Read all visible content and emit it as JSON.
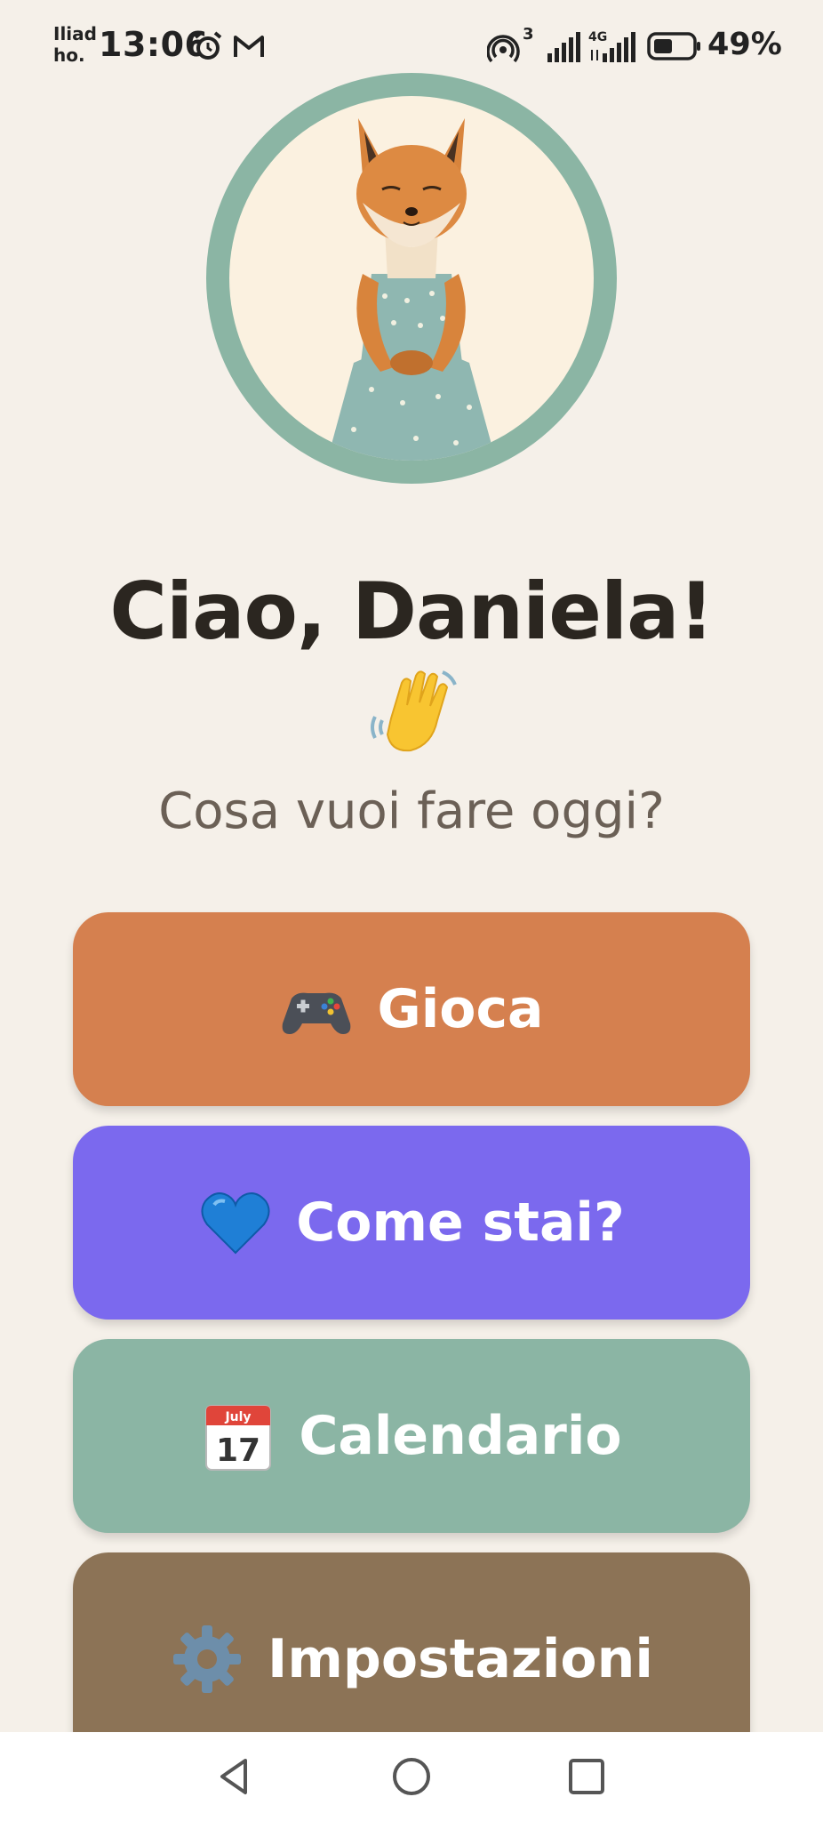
{
  "status_bar": {
    "carrier_line1": "Iliad",
    "carrier_line2": "ho.",
    "time": "13:06",
    "battery": "49%",
    "icons": [
      "alarm-icon",
      "gmail-icon",
      "hotspot-icon",
      "signal-icon",
      "4g-signal-icon",
      "battery-icon"
    ],
    "hotspot_count": "3",
    "network": "4G"
  },
  "profile": {
    "avatar_icon": "fox-avatar",
    "ring_color": "#8bb5a4"
  },
  "greeting": {
    "title": "Ciao, Daniela!",
    "emoji_icon": "waving-hand-icon",
    "subtitle": "Cosa vuoi fare oggi?"
  },
  "menu": [
    {
      "label": "Gioca",
      "icon": "gamepad-icon",
      "color": "#d5804f"
    },
    {
      "label": "Come stai?",
      "icon": "blue-heart-icon",
      "color": "#7b69ee"
    },
    {
      "label": "Calendario",
      "icon": "calendar-icon",
      "color": "#8bb5a4",
      "icon_month": "July",
      "icon_day": "17"
    },
    {
      "label": "Impostazioni",
      "icon": "gear-icon",
      "color": "#8c7356"
    }
  ],
  "navigation": [
    "back-icon",
    "home-icon",
    "recents-icon"
  ]
}
